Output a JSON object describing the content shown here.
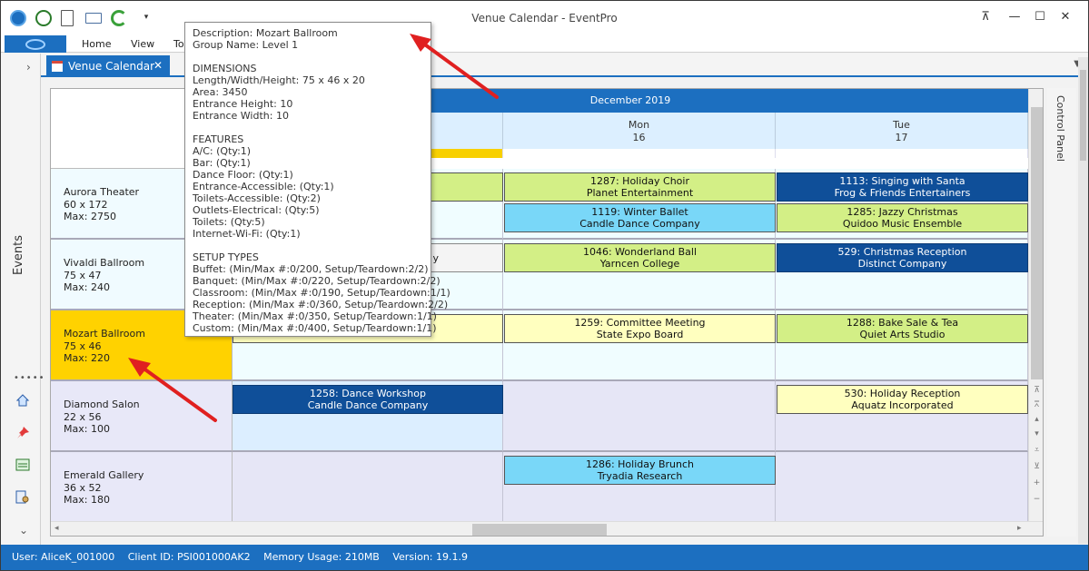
{
  "window": {
    "title": "Venue Calendar - EventPro"
  },
  "ribbon": {
    "tabs": [
      "Home",
      "View",
      "To"
    ]
  },
  "left_nav": {
    "events_label": "Events",
    "chevron": "›",
    "chevron_down": "⌄"
  },
  "doc_tab": {
    "label": "Venue Calendar",
    "close": "✕"
  },
  "control_panel": {
    "label": "Control Panel"
  },
  "calendar": {
    "month_label": "December 2019",
    "days": [
      {
        "name": "Mon",
        "date": "16"
      },
      {
        "name": "Tue",
        "date": "17"
      }
    ],
    "rooms": [
      {
        "name": "Aurora Theater",
        "size": "60 x 172",
        "max": "Max: 2750"
      },
      {
        "name": "Vivaldi Ballroom",
        "size": "75 x 47",
        "max": "Max: 240"
      },
      {
        "name": "Mozart Ballroom",
        "size": "75 x 46",
        "max": "Max: 220"
      },
      {
        "name": "Diamond Salon",
        "size": "22 x 56",
        "max": "Max: 100"
      },
      {
        "name": "Emerald Gallery",
        "size": "36 x 52",
        "max": "Max: 180"
      }
    ],
    "events": {
      "e1287": {
        "title": "1287: Holiday Choir",
        "client": "Planet Entertainment"
      },
      "e1113": {
        "title": "1113: Singing with Santa",
        "client": "Frog & Friends Entertainers"
      },
      "e1119": {
        "title": "1119: Winter Ballet",
        "client": "Candle Dance Company"
      },
      "e1285": {
        "title": "1285: Jazzy Christmas",
        "client": "Quidoo Music Ensemble"
      },
      "e1046": {
        "title": "1046: Wonderland Ball",
        "client": "Yarncen College"
      },
      "e529": {
        "title": "529: Christmas Reception",
        "client": "Distinct Company"
      },
      "partial_vivaldi": {
        "tail": "y"
      },
      "e1259": {
        "title": "1259: Committee Meeting",
        "client": "State Expo Board"
      },
      "e1288": {
        "title": "1288: Bake Sale & Tea",
        "client": "Quiet Arts Studio"
      },
      "e1258": {
        "title": "1258: Dance Workshop",
        "client": "Candle Dance Company"
      },
      "e530": {
        "title": "530: Holiday Reception",
        "client": "Aquatz Incorporated"
      },
      "e1286": {
        "title": "1286: Holiday Brunch",
        "client": "Tryadia Research"
      }
    }
  },
  "tooltip": {
    "description": "Description: Mozart Ballroom",
    "group": "Group Name: Level 1",
    "dimensions_header": "DIMENSIONS",
    "dimensions": [
      "Length/Width/Height: 75 x 46 x 20",
      "Area: 3450",
      "Entrance Height: 10",
      "Entrance Width: 10"
    ],
    "features_header": "FEATURES",
    "features": [
      "A/C: (Qty:1)",
      "Bar: (Qty:1)",
      "Dance Floor: (Qty:1)",
      "Entrance-Accessible: (Qty:1)",
      "Toilets-Accessible: (Qty:2)",
      "Outlets-Electrical: (Qty:5)",
      "Toilets: (Qty:5)",
      "Internet-Wi-Fi: (Qty:1)"
    ],
    "setup_header": "SETUP TYPES",
    "setup_types": [
      "Buffet: (Min/Max #:0/200, Setup/Teardown:2/2)",
      "Banquet: (Min/Max #:0/220, Setup/Teardown:2/2)",
      "Classroom: (Min/Max #:0/190, Setup/Teardown:1/1)",
      "Reception: (Min/Max #:0/360, Setup/Teardown:2/2)",
      "Theater: (Min/Max #:0/350, Setup/Teardown:1/1)",
      "Custom: (Min/Max #:0/400, Setup/Teardown:1/1)"
    ]
  },
  "status_bar": {
    "user": "User: AliceK_001000",
    "client": "Client ID: PSI001000AK2",
    "memory": "Memory Usage: 210MB",
    "version": "Version: 19.1.9"
  },
  "colors": {
    "accent": "#1c6fc0",
    "selected_room": "#ffd200",
    "event_green": "#d3ef86",
    "event_blue": "#0f4f99",
    "event_cyan": "#79d7f8",
    "event_yellow": "#ffffbf",
    "annotation_arrow": "#e02020"
  }
}
